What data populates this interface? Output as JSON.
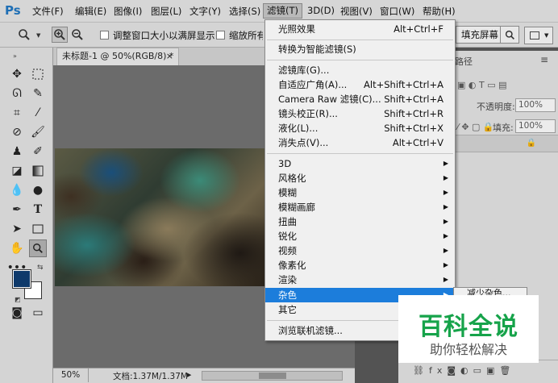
{
  "app": {
    "logo": "Ps",
    "menus": [
      "文件(F)",
      "编辑(E)",
      "图像(I)",
      "图层(L)",
      "文字(Y)",
      "选择(S)",
      "滤镜(T)",
      "3D(D)",
      "视图(V)",
      "窗口(W)",
      "帮助(H)"
    ],
    "active_menu": "滤镜(T)"
  },
  "options_bar": {
    "fit_window_label": "调整窗口大小以满屏显示",
    "zoom_all_label": "缩放所有",
    "fill_screen_label": "填充屏幕"
  },
  "document": {
    "tab_title": "未标题-1 @ 50%(RGB/8) *",
    "zoom": "50%",
    "doc_info": "文档:1.37M/1.37M"
  },
  "right_panel": {
    "tab_label": "路径",
    "opacity_label": "不透明度:",
    "opacity_value": "100%",
    "fill_label": "填充:",
    "fill_value": "100%"
  },
  "filter_menu": {
    "items": [
      {
        "label": "光照效果",
        "shortcut": "Alt+Ctrl+F"
      },
      {
        "label": "转换为智能滤镜(S)",
        "shortcut": ""
      },
      {
        "label": "滤镜库(G)...",
        "shortcut": ""
      },
      {
        "label": "自适应广角(A)...",
        "shortcut": "Alt+Shift+Ctrl+A"
      },
      {
        "label": "Camera Raw 滤镜(C)...",
        "shortcut": "Shift+Ctrl+A"
      },
      {
        "label": "镜头校正(R)...",
        "shortcut": "Shift+Ctrl+R"
      },
      {
        "label": "液化(L)...",
        "shortcut": "Shift+Ctrl+X"
      },
      {
        "label": "消失点(V)...",
        "shortcut": "Alt+Ctrl+V"
      },
      {
        "label": "3D",
        "shortcut": ""
      },
      {
        "label": "风格化",
        "shortcut": ""
      },
      {
        "label": "模糊",
        "shortcut": ""
      },
      {
        "label": "模糊画廊",
        "shortcut": ""
      },
      {
        "label": "扭曲",
        "shortcut": ""
      },
      {
        "label": "锐化",
        "shortcut": ""
      },
      {
        "label": "视频",
        "shortcut": ""
      },
      {
        "label": "像素化",
        "shortcut": ""
      },
      {
        "label": "渲染",
        "shortcut": ""
      },
      {
        "label": "杂色",
        "shortcut": ""
      },
      {
        "label": "其它",
        "shortcut": ""
      },
      {
        "label": "浏览联机滤镜...",
        "shortcut": ""
      }
    ],
    "highlighted": "杂色"
  },
  "submenu": {
    "first_item": "减少杂色..."
  },
  "watermark": {
    "title": "百科全说",
    "subtitle": "助你轻松解决"
  },
  "colors": {
    "foreground": "#0f3a6b",
    "background": "#ffffff",
    "menu_highlight": "#1c7ddb",
    "watermark_green": "#16a34a"
  }
}
